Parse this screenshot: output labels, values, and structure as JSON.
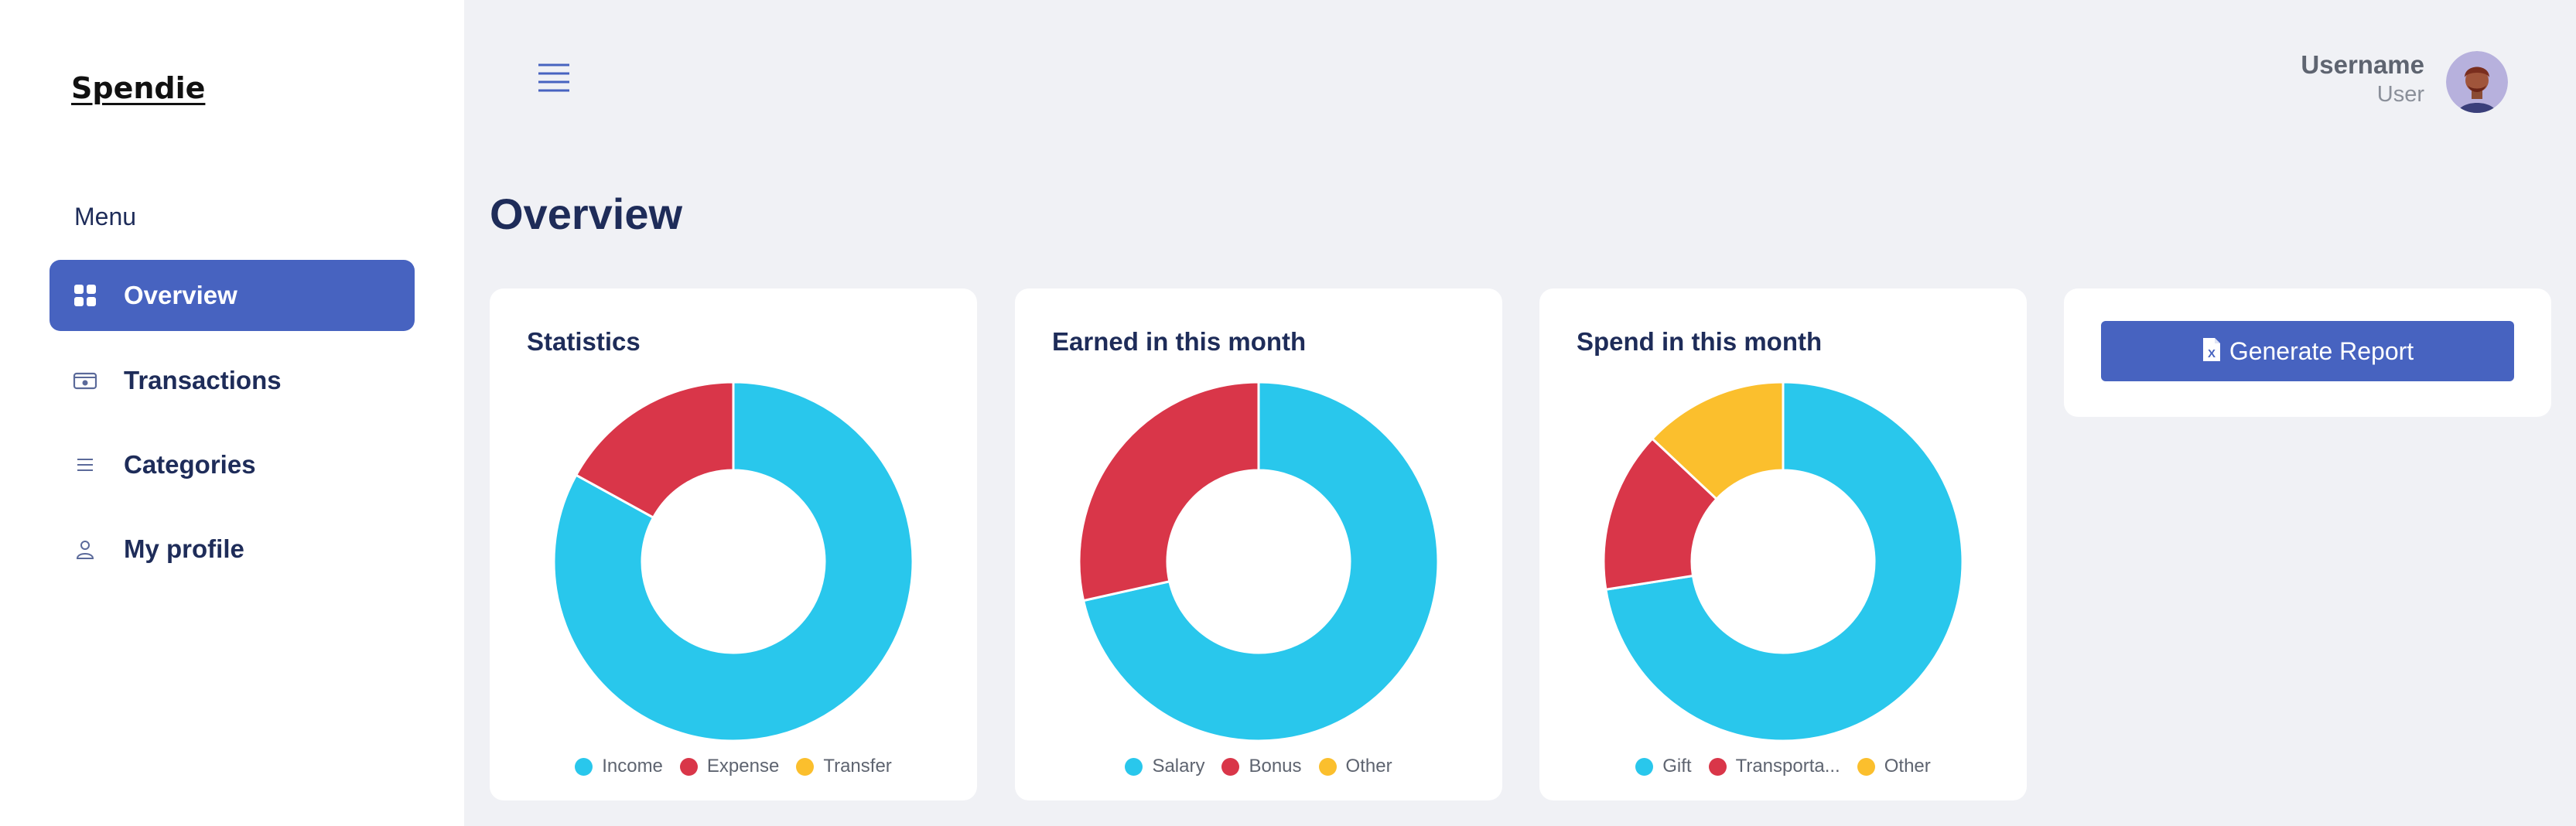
{
  "app": {
    "logo": "Spendie"
  },
  "sidebar": {
    "menu_label": "Menu",
    "items": [
      {
        "label": "Overview",
        "icon": "grid-icon",
        "active": true
      },
      {
        "label": "Transactions",
        "icon": "cash-icon",
        "active": false
      },
      {
        "label": "Categories",
        "icon": "list-icon",
        "active": false
      },
      {
        "label": "My profile",
        "icon": "user-icon",
        "active": false
      }
    ]
  },
  "header": {
    "menu_icon": "hamburger-icon",
    "username": "Username",
    "role": "User"
  },
  "main": {
    "title": "Overview",
    "report_button": {
      "label": "Generate Report",
      "icon": "excel-file-icon"
    }
  },
  "colors": {
    "accent": "#4763c0",
    "cyan": "#29c7ec",
    "red": "#d93649",
    "yellow": "#fbbf2d",
    "navy": "#1e2c59"
  },
  "chart_data": [
    {
      "type": "pie",
      "title": "Statistics",
      "categories": [
        "Income",
        "Expense",
        "Transfer"
      ],
      "values": [
        83,
        17,
        0
      ],
      "colors": [
        "#29c7ec",
        "#d93649",
        "#fbbf2d"
      ]
    },
    {
      "type": "pie",
      "title": "Earned in this month",
      "categories": [
        "Salary",
        "Bonus",
        "Other"
      ],
      "values": [
        71.5,
        28.5,
        0
      ],
      "colors": [
        "#29c7ec",
        "#d93649",
        "#fbbf2d"
      ]
    },
    {
      "type": "pie",
      "title": "Spend in this month",
      "categories": [
        "Gift",
        "Transporta...",
        "Other"
      ],
      "values": [
        72.5,
        14.5,
        13
      ],
      "colors": [
        "#29c7ec",
        "#d93649",
        "#fbbf2d"
      ]
    }
  ]
}
